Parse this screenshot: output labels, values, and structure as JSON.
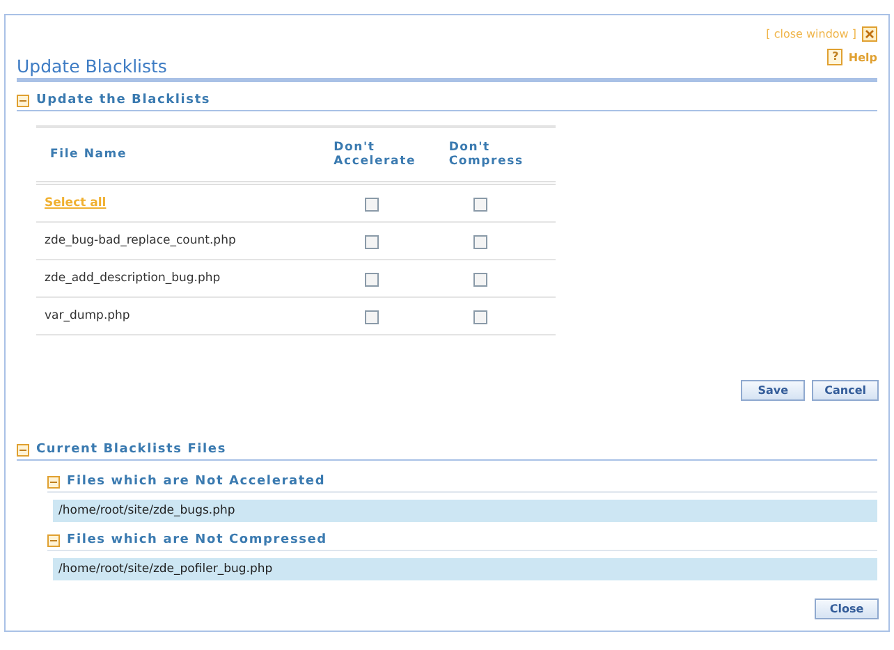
{
  "close_link": "[ close window ]",
  "title": "Update Blacklists",
  "help": "Help",
  "help_icon": "?",
  "update_section": {
    "title": "Update the Blacklists",
    "expanded": true,
    "columns": [
      "File Name",
      "Don't Accelerate",
      "Don't Compress"
    ],
    "rows": [
      {
        "kind": "link",
        "name": "Select all",
        "no_accelerate": false,
        "no_compress": false
      },
      {
        "kind": "file",
        "name": "zde_bug-bad_replace_count.php",
        "no_accelerate": false,
        "no_compress": false
      },
      {
        "kind": "file",
        "name": "zde_add_description_bug.php",
        "no_accelerate": false,
        "no_compress": false
      },
      {
        "kind": "file",
        "name": "var_dump.php",
        "no_accelerate": false,
        "no_compress": false
      }
    ],
    "buttons": [
      "Save",
      "Cancel"
    ]
  },
  "current_section": {
    "title": "Current Blacklists Files",
    "expanded": true,
    "groups": [
      {
        "title": "Files which are Not Accelerated",
        "expanded": true,
        "files": [
          "/home/root/site/zde_bugs.php"
        ]
      },
      {
        "title": "Files which are Not Compressed",
        "expanded": true,
        "files": [
          "/home/root/site/zde_pofiler_bug.php"
        ]
      }
    ]
  },
  "close_button": "Close"
}
